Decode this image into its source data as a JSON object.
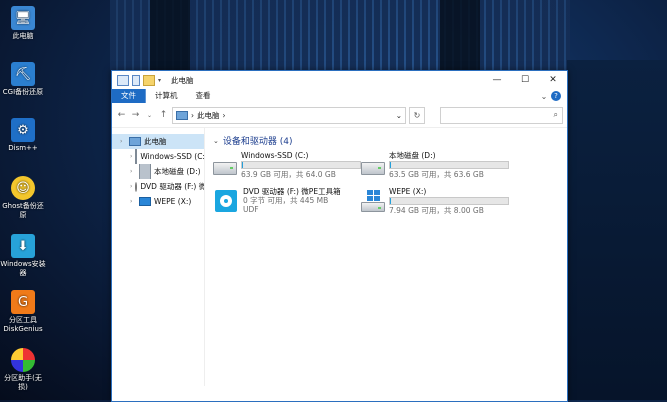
{
  "desktop": {
    "icons": [
      {
        "label": "此电脑"
      },
      {
        "label": "CGI备份还原"
      },
      {
        "label": "Dism++"
      },
      {
        "label": "Ghost备份还原"
      },
      {
        "label": "Windows安装器"
      },
      {
        "label": "分区工具DiskGenius"
      },
      {
        "label": "分区助手(无损)"
      }
    ]
  },
  "window": {
    "title": "此电脑",
    "controls": {
      "minimize": "—",
      "maximize": "☐",
      "close": "✕"
    },
    "ribbon_tabs": [
      {
        "label": "文件"
      },
      {
        "label": "计算机"
      },
      {
        "label": "查看"
      }
    ],
    "address": {
      "breadcrumb": "此电脑",
      "sep": "›",
      "dropdown": "⌄",
      "refresh": "↻"
    },
    "search": {
      "icon": "⌕"
    },
    "nav_pane": [
      {
        "label": "此电脑",
        "icon": "pc-icon"
      },
      {
        "label": "Windows-SSD (C:)",
        "icon": "drive-icon"
      },
      {
        "label": "本地磁盘 (D:)",
        "icon": "drive-icon"
      },
      {
        "label": "DVD 驱动器 (F:) 微",
        "icon": "dvd-icon"
      },
      {
        "label": "WEPE (X:)",
        "icon": "windows-drive-icon"
      }
    ],
    "group": {
      "title": "设备和驱动器 (4)"
    },
    "drives": [
      {
        "name": "Windows-SSD (C:)",
        "detail": "63.9 GB 可用，共 64.0 GB",
        "fill": 0.002,
        "type": "hdd"
      },
      {
        "name": "本地磁盘 (D:)",
        "detail": "63.5 GB 可用，共 63.6 GB",
        "fill": 0.002,
        "type": "hdd"
      },
      {
        "name": "DVD 驱动器 (F:) 微PE工具箱",
        "detail": "0 字节 可用，共 445 MB",
        "detail2": "UDF",
        "fill": 1.0,
        "type": "dvd"
      },
      {
        "name": "WEPE (X:)",
        "detail": "7.94 GB 可用，共 8.00 GB",
        "fill": 0.008,
        "type": "wepe"
      }
    ]
  }
}
